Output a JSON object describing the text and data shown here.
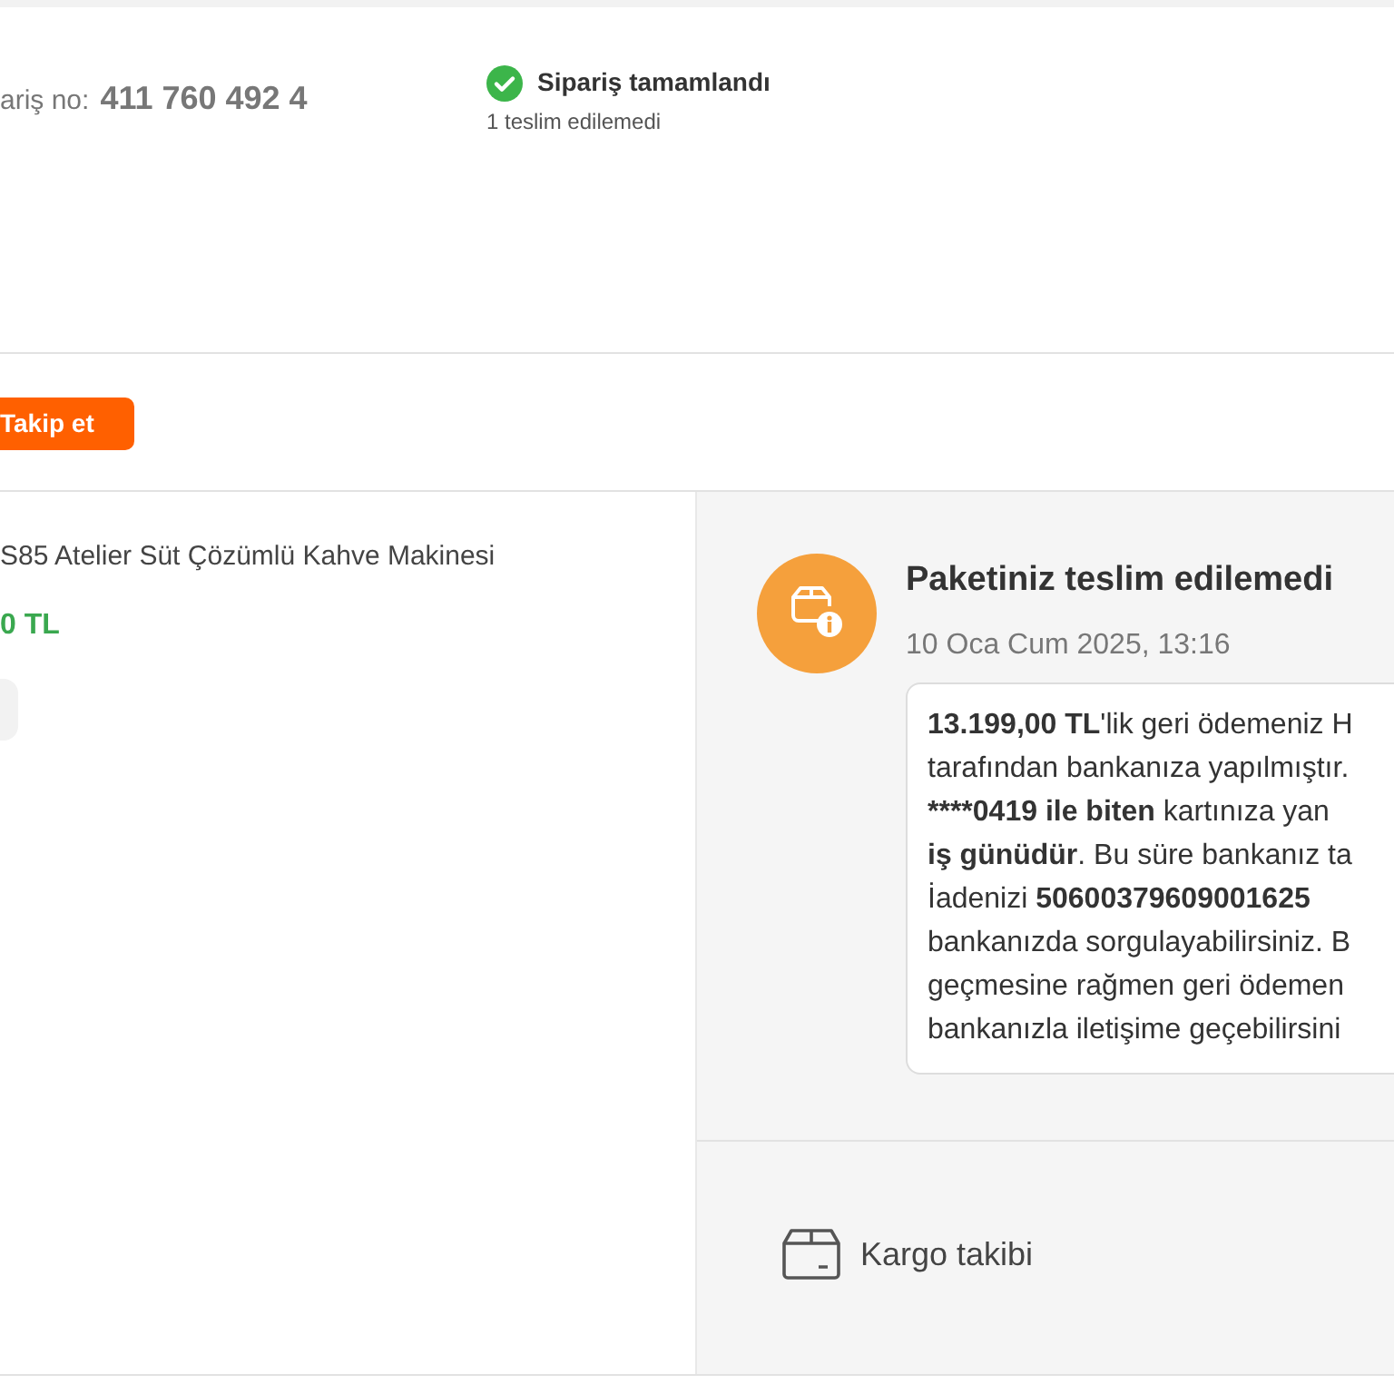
{
  "order": {
    "label": "ariş no:",
    "number": "411 760 492 4"
  },
  "status": {
    "title": "Sipariş tamamlandı",
    "subtitle": "1 teslim edilemedi"
  },
  "track_button": {
    "label": "Takip et"
  },
  "product": {
    "name": "S85 Atelier Süt Çözümlü Kahve Makinesi",
    "price": "0 TL"
  },
  "event": {
    "title": "Paketiniz teslim edilemedi",
    "date": "10 Oca Cum 2025, 13:16",
    "message_lines": [
      [
        {
          "text": "13.199,00 TL",
          "bold": true
        },
        {
          "text": "'lik geri ödemeniz H",
          "bold": false
        }
      ],
      [
        {
          "text": "tarafından bankanıza yapılmıştır.",
          "bold": false
        }
      ],
      [
        {
          "text": "****0419 ile biten",
          "bold": true
        },
        {
          "text": " kartınıza yan",
          "bold": false
        }
      ],
      [
        {
          "text": "iş günüdür",
          "bold": true
        },
        {
          "text": ". Bu süre bankanız ta",
          "bold": false
        }
      ],
      [
        {
          "text": "İadenizi ",
          "bold": false
        },
        {
          "text": "50600379609001625",
          "bold": true
        }
      ],
      [
        {
          "text": "bankanızda sorgulayabilirsiniz. B",
          "bold": false
        }
      ],
      [
        {
          "text": "geçmesine rağmen geri ödemen",
          "bold": false
        }
      ],
      [
        {
          "text": "bankanızla iletişime geçebilirsini",
          "bold": false
        }
      ]
    ]
  },
  "shipment_link": {
    "label": "Kargo takibi"
  }
}
